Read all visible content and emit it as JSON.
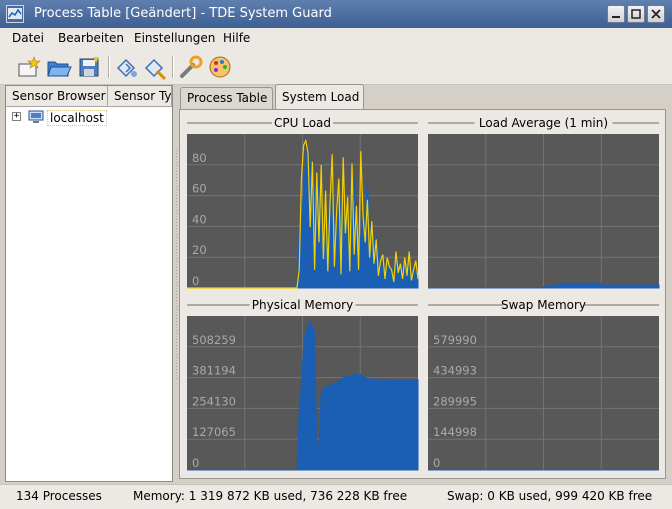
{
  "window": {
    "title": "Process Table [Geändert] - TDE System Guard"
  },
  "menu": {
    "items": [
      "Datei",
      "Bearbeiten",
      "Einstellungen",
      "Hilfe"
    ]
  },
  "toolbar": {
    "icons": [
      "new-sheet-icon",
      "open-folder-icon",
      "save-icon",
      "connect-host-icon",
      "disconnect-host-icon",
      "configure-wrench-icon",
      "configure-style-icon"
    ]
  },
  "sensor_browser": {
    "columns": [
      "Sensor Browser",
      "Sensor Typ"
    ],
    "items": [
      {
        "label": "localhost",
        "expander": "+"
      }
    ]
  },
  "tabs": [
    {
      "label": "Process Table",
      "active": false
    },
    {
      "label": "System Load",
      "active": true
    }
  ],
  "plots": [
    {
      "title": "CPU Load",
      "y_labels": [
        "80",
        "60",
        "40",
        "20",
        "0"
      ],
      "max": 100,
      "series": [
        {
          "color": "#1a5fb4",
          "values": [
            0,
            0,
            0,
            0,
            0,
            0,
            0,
            0,
            0,
            0,
            0,
            0,
            0,
            0,
            0,
            0,
            0,
            0,
            0,
            0,
            0,
            0,
            0,
            0,
            0,
            0,
            0,
            0,
            0,
            0,
            0,
            0,
            0,
            0,
            0,
            0,
            0,
            0,
            0,
            0,
            0,
            0,
            0,
            0,
            0,
            0,
            0,
            0,
            0,
            0,
            0,
            37,
            44,
            63,
            86,
            91,
            84,
            78,
            60,
            48,
            71,
            58,
            43,
            39,
            44,
            52,
            67,
            40,
            33,
            48,
            56,
            66,
            52,
            31,
            43,
            58,
            72,
            40,
            30,
            34,
            43,
            48,
            70,
            44,
            33,
            30,
            34,
            24,
            18,
            12,
            16,
            20,
            13,
            10,
            15,
            18,
            12,
            11,
            16,
            14,
            12,
            16,
            15,
            11,
            10,
            8
          ]
        },
        {
          "color": "#f4d000",
          "values": [
            0,
            0,
            0,
            0,
            0,
            0,
            0,
            0,
            0,
            0,
            0,
            0,
            0,
            0,
            0,
            0,
            0,
            0,
            0,
            0,
            0,
            0,
            0,
            0,
            0,
            0,
            0,
            0,
            0,
            0,
            0,
            0,
            0,
            0,
            0,
            0,
            0,
            0,
            0,
            0,
            0,
            0,
            0,
            0,
            0,
            0,
            0,
            0,
            0,
            0,
            0,
            12,
            72,
            94,
            97,
            89,
            40,
            83,
            12,
            76,
            30,
            81,
            19,
            64,
            11,
            56,
            88,
            14,
            50,
            72,
            9,
            86,
            36,
            60,
            11,
            82,
            22,
            54,
            12,
            90,
            48,
            30,
            58,
            20,
            44,
            16,
            32,
            8,
            18,
            22,
            6,
            20,
            14,
            12,
            4,
            24,
            10,
            16,
            6,
            20,
            8,
            24,
            5,
            12,
            18,
            6
          ]
        }
      ]
    },
    {
      "title": "Load Average (1 min)",
      "y_labels": [],
      "max": 100,
      "series": [
        {
          "color": "#1a5fb4",
          "values": [
            0,
            0,
            0,
            0,
            0,
            0,
            0,
            0,
            0,
            0,
            0,
            0,
            0,
            0,
            0,
            0,
            0,
            0,
            0,
            0,
            0,
            0,
            0,
            0,
            0,
            0,
            0,
            0,
            0,
            0,
            0,
            0,
            0,
            0,
            0,
            0,
            0,
            0,
            0,
            0,
            0,
            0,
            0,
            0,
            0,
            0,
            0,
            0,
            0,
            0,
            0,
            0,
            1,
            1,
            1,
            1,
            2,
            2,
            2,
            2,
            3,
            3,
            3,
            3,
            3,
            3,
            3,
            3,
            3,
            3,
            3,
            3,
            3,
            3,
            3,
            3,
            3,
            3,
            3,
            2,
            2,
            2,
            2,
            2,
            2,
            2,
            2,
            2,
            2,
            2,
            2,
            2,
            2,
            2,
            2,
            2,
            2,
            2,
            2,
            2,
            2,
            2,
            2,
            2,
            2
          ]
        }
      ]
    },
    {
      "title": "Physical Memory",
      "y_labels": [
        "508259",
        "381194",
        "254130",
        "127065",
        "0"
      ],
      "max": 635324,
      "series": [
        {
          "color": "#1a5fb4",
          "values": [
            0,
            0,
            0,
            0,
            0,
            0,
            0,
            0,
            0,
            0,
            0,
            0,
            0,
            0,
            0,
            0,
            0,
            0,
            0,
            0,
            0,
            0,
            0,
            0,
            0,
            0,
            0,
            0,
            0,
            0,
            0,
            0,
            0,
            0,
            0,
            0,
            0,
            0,
            0,
            0,
            0,
            0,
            0,
            0,
            0,
            0,
            0,
            0,
            0,
            0,
            0,
            250000,
            350000,
            520000,
            580000,
            600000,
            620000,
            600000,
            575000,
            100000,
            100000,
            320000,
            335000,
            350000,
            350000,
            350000,
            360000,
            365000,
            360000,
            375000,
            380000,
            385000,
            390000,
            390000,
            395000,
            395000,
            400000,
            400000,
            395000,
            400000,
            390000,
            385000,
            382000,
            380000,
            380000,
            380000,
            378000,
            378000,
            378000,
            378000,
            378000,
            377000,
            377000,
            377000,
            377000,
            377000,
            377000,
            377000,
            377000,
            377000,
            377000,
            377000,
            377000,
            377000,
            377000,
            377000
          ]
        }
      ]
    },
    {
      "title": "Swap Memory",
      "y_labels": [
        "579990",
        "434993",
        "289995",
        "144998",
        "0"
      ],
      "max": 724988,
      "series": [
        {
          "color": "#1a5fb4",
          "values": [
            0,
            0,
            0,
            0,
            0,
            0,
            0,
            0,
            0,
            0,
            0,
            0,
            0,
            0,
            0,
            0,
            0,
            0,
            0,
            0,
            0,
            0,
            0,
            0,
            0,
            0,
            0,
            0,
            0,
            0,
            0,
            0,
            0,
            0,
            0,
            0,
            0,
            0,
            0,
            0,
            0,
            0,
            0,
            0,
            0,
            0,
            0,
            0,
            0,
            0,
            0,
            0,
            0,
            0,
            0,
            0,
            0,
            0,
            0,
            0,
            0,
            0,
            0,
            0,
            0,
            0,
            0,
            0,
            0,
            0,
            0,
            0,
            0,
            0,
            0,
            0,
            0,
            0,
            0,
            0,
            0,
            0,
            0,
            0,
            0,
            0,
            0,
            0,
            0,
            0,
            0,
            0,
            0,
            0,
            0,
            0,
            0,
            0,
            0,
            0,
            0,
            0,
            0,
            0,
            0,
            0
          ]
        }
      ]
    }
  ],
  "status": {
    "processes": "134 Processes",
    "memory": "Memory: 1 319 872 KB used, 736 228 KB free",
    "swap": "Swap: 0 KB used, 999 420 KB free"
  }
}
